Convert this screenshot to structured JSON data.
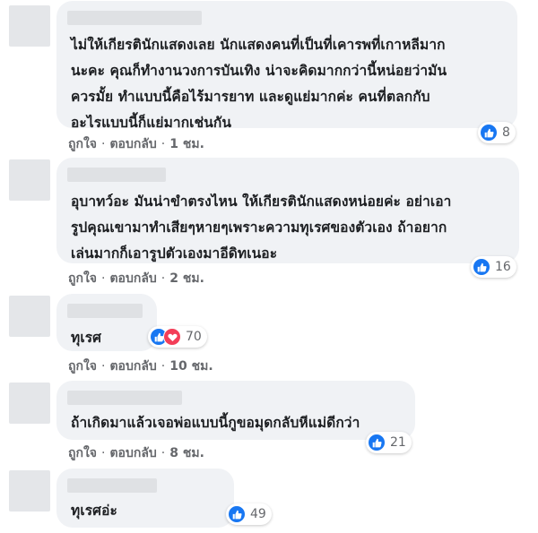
{
  "actions": {
    "like": "ถูกใจ",
    "reply": "ตอบกลับ",
    "separator": "·"
  },
  "comments": [
    {
      "lines": [
        "ไม่ให้เกียรตินักแสดงเลย นักแสดงคนที่เป็นที่เคารพที่เกาหลีมาก",
        "นะคะ คุณก็ทำงานวงการบันเทิง น่าจะคิดมากกว่านี้หน่อยว่ามัน",
        "ควรมั้ย ทำแบบนี้คือไร้มารยาท และดูแย่มากค่ะ คนที่ตลกกับ",
        "อะไรแบบนี้ก็แย่มากเช่นกัน"
      ],
      "time": "1 ชม.",
      "reaction_count": "8",
      "reaction_icons": [
        "like-icon"
      ]
    },
    {
      "lines": [
        "อุบาทว์อะ มันน่าขำตรงไหน ให้เกียรตินักแสดงหน่อยค่ะ อย่าเอา",
        "รูปคุณเขามาทำเสียๆหายๆเพราะความทุเรศของตัวเอง ถ้าอยาก",
        "เล่นมากก็เอารูปตัวเองมาอีดิทเนอะ"
      ],
      "time": "2 ชม.",
      "reaction_count": "16",
      "reaction_icons": [
        "like-icon"
      ]
    },
    {
      "lines": [
        "ทุเรศ"
      ],
      "time": "10 ชม.",
      "reaction_count": "70",
      "reaction_icons": [
        "like-icon",
        "love-icon"
      ]
    },
    {
      "lines": [
        "ถ้าเกิดมาแล้วเจอพ่อแบบนี้กูขอมุดกลับหีแม่ดีกว่า"
      ],
      "time": "8 ชม.",
      "reaction_count": "21",
      "reaction_icons": [
        "like-icon"
      ]
    },
    {
      "lines": [
        "ทุเรศอ่ะ"
      ],
      "time": "",
      "reaction_count": "49",
      "reaction_icons": [
        "like-icon"
      ]
    }
  ],
  "colors": {
    "bubble": "#f0f2f5",
    "meta_text": "#65676b",
    "like_blue": "#1877f2",
    "love_red": "#f33e58"
  }
}
